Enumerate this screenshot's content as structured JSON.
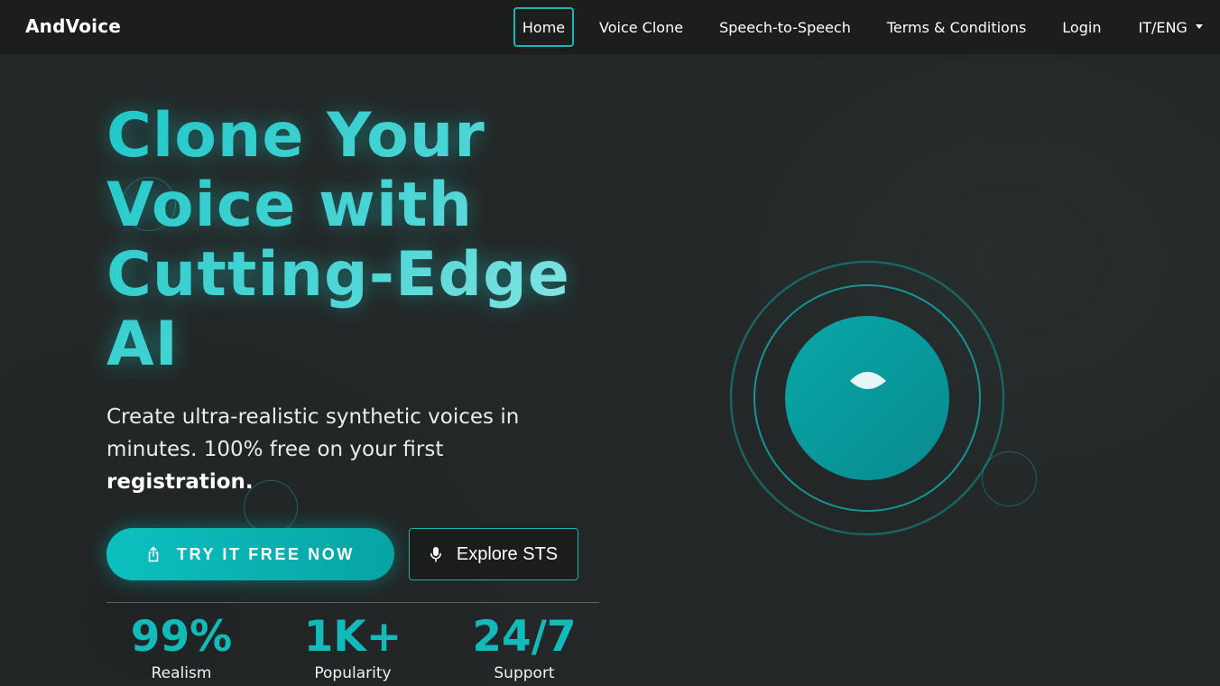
{
  "brand": "AndVoice",
  "nav": {
    "items": [
      {
        "label": "Home",
        "active": true
      },
      {
        "label": "Voice Clone"
      },
      {
        "label": "Speech-to-Speech"
      },
      {
        "label": "Terms & Conditions"
      },
      {
        "label": "Login"
      },
      {
        "label": "IT/ENG",
        "icon": "caret-down-icon"
      }
    ]
  },
  "hero": {
    "title_lines": [
      "Clone Your",
      "Voice with",
      "Cutting-Edge",
      "AI"
    ],
    "subtitle_pre": "Create ultra-realistic synthetic voices in minutes. 100% free on your first ",
    "subtitle_bold": "registration.",
    "primary_button": {
      "label": "TRY IT FREE NOW",
      "icon": "share-icon"
    },
    "secondary_button": {
      "label": "Explore STS",
      "icon": "microphone-icon"
    }
  },
  "stats": [
    {
      "value": "99%",
      "label": "Realism"
    },
    {
      "value": "1K+",
      "label": "Popularity"
    },
    {
      "value": "24/7",
      "label": "Support"
    }
  ],
  "colors": {
    "accent": "#12baba",
    "background": "#232727",
    "navbar": "#1c1e1e"
  }
}
